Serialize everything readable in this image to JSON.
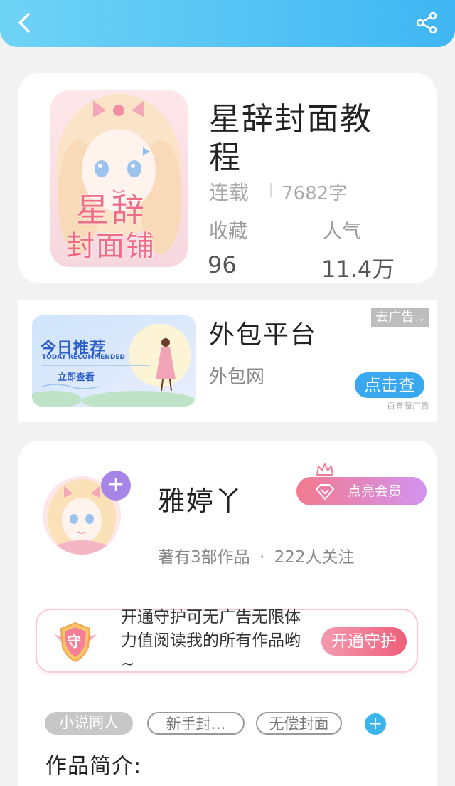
{
  "header": {
    "back_icon": "chevron-left-icon",
    "share_icon": "share-icon",
    "gradient": [
      "#6fd3f5",
      "#3fb6f3"
    ]
  },
  "book": {
    "title": "星辞封面教程",
    "status": "连载",
    "word_count": "7682字",
    "favorites_label": "收藏",
    "favorites_value": "96",
    "popularity_label": "人气",
    "popularity_value": "11.4万",
    "cover_text_line1": "星辞",
    "cover_text_line2": "封面铺"
  },
  "ad": {
    "title": "外包平台",
    "subtitle": "外包网",
    "close_label": "去广告",
    "cta_label": "点击查",
    "source": "百青藤广告",
    "image_text_main": "今日推荐",
    "image_text_en": "TODAY RECOMMENDED",
    "image_text_cta": "立即查看"
  },
  "author": {
    "name": "雅婷丫",
    "works_count": "著有3部作品",
    "followers": "222人关注",
    "vip_label": "点亮会员",
    "follow_icon": "plus-icon"
  },
  "guard": {
    "badge_char": "守",
    "text": "开通守护可无广告无限体力值阅读我的所有作品哟~",
    "button_label": "开通守护"
  },
  "tags": [
    {
      "label": "小说同人",
      "active": true
    },
    {
      "label": "新手封…",
      "active": false
    },
    {
      "label": "无偿封面",
      "active": false
    }
  ],
  "intro": {
    "title": "作品简介:"
  },
  "colors": {
    "accent_blue": "#3aa8f0",
    "vip_pink": "#f27a8e",
    "guard_pink": "#ee5f7a",
    "plus_purple": "#a784e8"
  }
}
